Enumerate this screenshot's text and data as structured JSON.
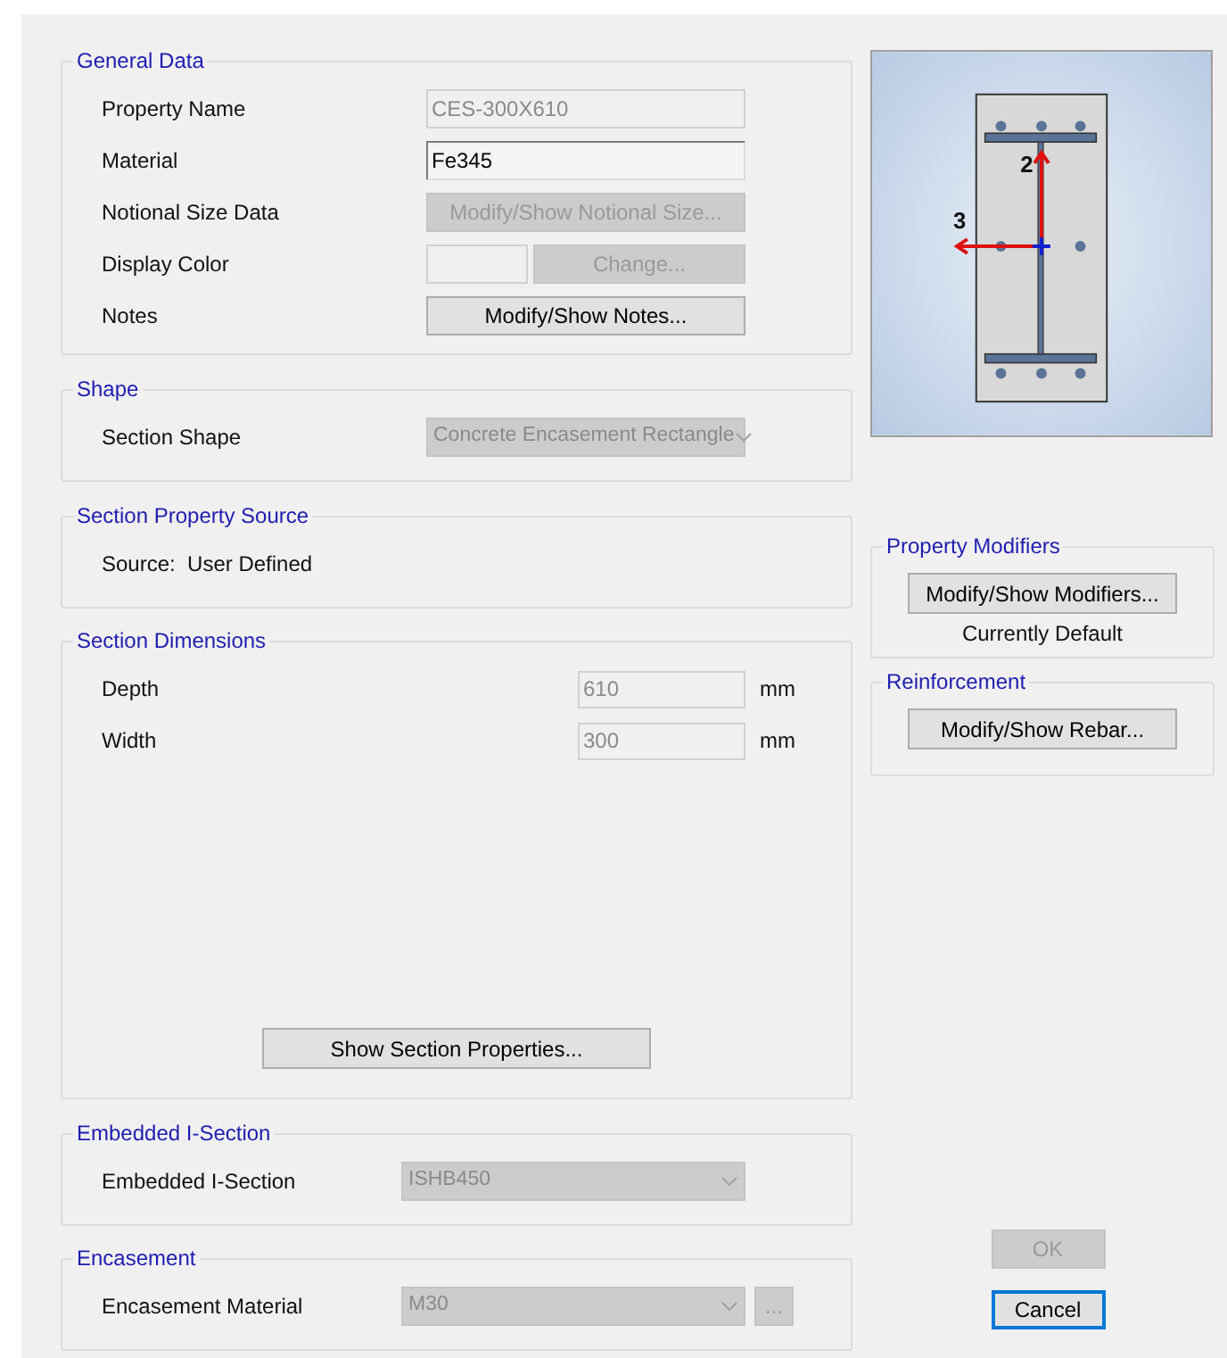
{
  "groups": [
    {
      "title": "General Data",
      "rows": [
        {
          "kind": "field",
          "label": "Property Name",
          "value": "CES-300X610",
          "disabled": true
        },
        {
          "kind": "field",
          "label": "Material",
          "value": "Fe345",
          "disabled": false
        },
        {
          "kind": "button",
          "label": "Notional Size Data",
          "button": "Modify/Show Notional Size...",
          "disabled": true
        },
        {
          "kind": "color",
          "label": "Display Color",
          "button": "Change...",
          "disabled": true
        },
        {
          "kind": "button",
          "label": "Notes",
          "button": "Modify/Show Notes...",
          "disabled": false
        }
      ]
    },
    {
      "title": "Shape",
      "rows": [
        {
          "kind": "dropdown",
          "label": "Section Shape",
          "value": "Concrete Encasement Rectangle",
          "disabled": true
        }
      ]
    },
    {
      "title": "Section Property Source",
      "rows": [
        {
          "kind": "static",
          "label": "Source:  User Defined"
        }
      ]
    },
    {
      "title": "Section Dimensions",
      "rows": [
        {
          "kind": "unit",
          "label": "Depth",
          "value": "610",
          "unit": "mm",
          "disabled": true
        },
        {
          "kind": "unit",
          "label": "Width",
          "value": "300",
          "unit": "mm",
          "disabled": true
        }
      ],
      "footer_button": {
        "label": "Show Section Properties...",
        "disabled": false
      }
    },
    {
      "title": "Embedded I-Section",
      "rows": [
        {
          "kind": "dropdown",
          "label": "Embedded I-Section",
          "value": "ISHB450",
          "disabled": true
        }
      ]
    },
    {
      "title": "Encasement",
      "rows": [
        {
          "kind": "dropdown",
          "label": "Encasement Material",
          "value": "M30",
          "disabled": true,
          "extra_button": "..."
        }
      ]
    }
  ],
  "preview": {
    "axis_vertical": "2",
    "axis_horizontal": "3"
  },
  "side_groups": [
    {
      "title": "Property Modifiers",
      "button": "Modify/Show Modifiers...",
      "note": "Currently Default"
    },
    {
      "title": "Reinforcement",
      "button": "Modify/Show Rebar..."
    }
  ],
  "dialog_buttons": [
    {
      "label": "OK",
      "disabled": true,
      "focused": false
    },
    {
      "label": "Cancel",
      "disabled": false,
      "focused": true
    }
  ]
}
